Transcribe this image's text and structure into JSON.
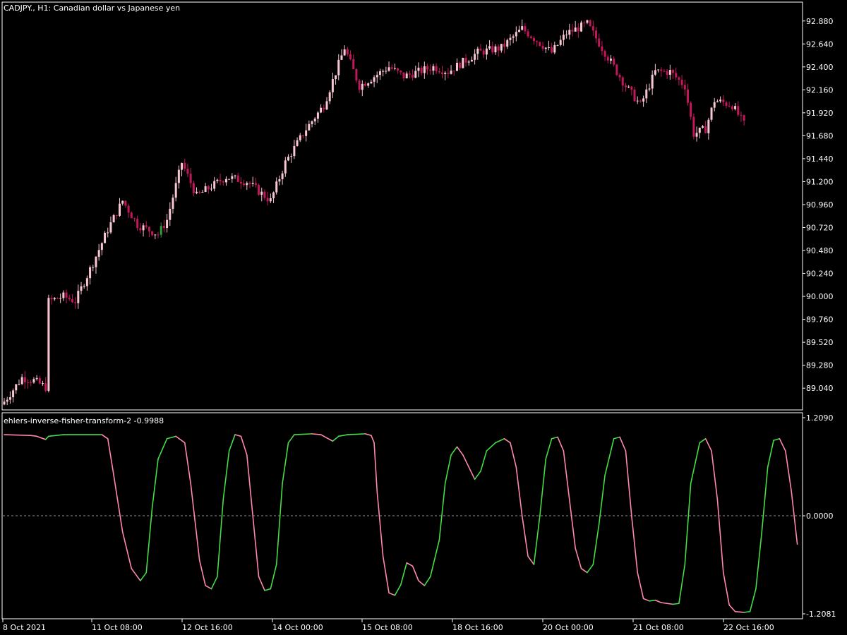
{
  "window": {
    "title": "CADJPY., H1:  Canadian dollar vs Japanese yen"
  },
  "indicator": {
    "name": "ehlers-inverse-fisher-transform-2",
    "last_value": "-0.9988"
  },
  "colors": {
    "background": "#000000",
    "frame": "#ffffff",
    "bear_candle": "#c2185b",
    "bull_candle": "#f8c7d2",
    "highlight_candle": "#2e9e3a",
    "indicator_up": "#44dd44",
    "indicator_down": "#ff88aa",
    "zero_line": "#8a8a8a"
  },
  "chart_data": [
    {
      "type": "candlestick",
      "title": "CADJPY., H1:  Canadian dollar vs Japanese yen",
      "symbol": "CADJPY.",
      "timeframe": "H1",
      "ylim": [
        88.82,
        93.07
      ],
      "y_ticks": [
        "92.880",
        "92.640",
        "92.400",
        "92.160",
        "91.920",
        "91.680",
        "91.440",
        "91.200",
        "90.960",
        "90.720",
        "90.480",
        "90.240",
        "90.000",
        "89.760",
        "89.520",
        "89.280",
        "89.040"
      ],
      "x_ticks": [
        "8 Oct 2021",
        "11 Oct 08:00",
        "12 Oct 16:00",
        "14 Oct 00:00",
        "15 Oct 08:00",
        "18 Oct 16:00",
        "20 Oct 00:00",
        "21 Oct 08:00",
        "22 Oct 16:00"
      ],
      "close_path": [
        [
          0,
          88.9
        ],
        [
          6,
          89.15
        ],
        [
          10,
          89.12
        ],
        [
          14,
          89.05
        ],
        [
          15,
          89.95
        ],
        [
          20,
          90.0
        ],
        [
          24,
          89.95
        ],
        [
          30,
          90.35
        ],
        [
          35,
          90.7
        ],
        [
          40,
          91.0
        ],
        [
          45,
          90.75
        ],
        [
          52,
          90.65
        ],
        [
          55,
          90.8
        ],
        [
          60,
          91.4
        ],
        [
          65,
          91.05
        ],
        [
          75,
          91.25
        ],
        [
          82,
          91.2
        ],
        [
          90,
          91.0
        ],
        [
          95,
          91.4
        ],
        [
          102,
          91.75
        ],
        [
          108,
          92.0
        ],
        [
          115,
          92.6
        ],
        [
          120,
          92.2
        ],
        [
          130,
          92.4
        ],
        [
          135,
          92.3
        ],
        [
          140,
          92.35
        ],
        [
          145,
          92.4
        ],
        [
          150,
          92.35
        ],
        [
          160,
          92.55
        ],
        [
          168,
          92.6
        ],
        [
          175,
          92.8
        ],
        [
          185,
          92.55
        ],
        [
          190,
          92.75
        ],
        [
          197,
          92.85
        ],
        [
          202,
          92.6
        ],
        [
          210,
          92.2
        ],
        [
          215,
          92.0
        ],
        [
          220,
          92.35
        ],
        [
          225,
          92.35
        ],
        [
          230,
          92.2
        ],
        [
          233,
          91.7
        ],
        [
          237,
          91.75
        ],
        [
          240,
          92.05
        ],
        [
          246,
          92.0
        ],
        [
          250,
          91.8
        ]
      ],
      "highlight_index": 53
    },
    {
      "type": "line",
      "title": "ehlers-inverse-fisher-transform-2 -0.9988",
      "ylim": [
        -1.2081,
        1.209
      ],
      "y_ticks": [
        "1.2090",
        "0.0000",
        "-1.2081"
      ],
      "reference_level": 0.0,
      "points": [
        [
          0,
          1.0
        ],
        [
          9,
          0.99
        ],
        [
          11,
          0.98
        ],
        [
          14,
          0.94
        ],
        [
          15,
          0.98
        ],
        [
          20,
          1.0
        ],
        [
          30,
          1.0
        ],
        [
          33,
          1.0
        ],
        [
          35,
          0.95
        ],
        [
          37,
          0.5
        ],
        [
          40,
          -0.2
        ],
        [
          43,
          -0.65
        ],
        [
          45,
          -0.75
        ],
        [
          46,
          -0.8
        ],
        [
          48,
          -0.7
        ],
        [
          50,
          0.1
        ],
        [
          52,
          0.7
        ],
        [
          55,
          0.95
        ],
        [
          58,
          0.98
        ],
        [
          61,
          0.9
        ],
        [
          63,
          0.4
        ],
        [
          66,
          -0.55
        ],
        [
          68,
          -0.86
        ],
        [
          70,
          -0.9
        ],
        [
          72,
          -0.75
        ],
        [
          74,
          0.2
        ],
        [
          76,
          0.8
        ],
        [
          78,
          1.0
        ],
        [
          80,
          0.98
        ],
        [
          82,
          0.75
        ],
        [
          84,
          0.0
        ],
        [
          86,
          -0.75
        ],
        [
          88,
          -0.92
        ],
        [
          90,
          -0.9
        ],
        [
          92,
          -0.6
        ],
        [
          94,
          0.4
        ],
        [
          96,
          0.9
        ],
        [
          98,
          1.0
        ],
        [
          104,
          1.01
        ],
        [
          107,
          1.0
        ],
        [
          110,
          0.94
        ],
        [
          111,
          0.92
        ],
        [
          113,
          0.98
        ],
        [
          116,
          1.0
        ],
        [
          122,
          1.01
        ],
        [
          124,
          0.99
        ],
        [
          125,
          0.9
        ],
        [
          126,
          0.3
        ],
        [
          128,
          -0.5
        ],
        [
          130,
          -0.95
        ],
        [
          132,
          -0.98
        ],
        [
          134,
          -0.85
        ],
        [
          136,
          -0.58
        ],
        [
          138,
          -0.62
        ],
        [
          140,
          -0.8
        ],
        [
          142,
          -0.86
        ],
        [
          144,
          -0.75
        ],
        [
          147,
          -0.3
        ],
        [
          149,
          0.4
        ],
        [
          151,
          0.75
        ],
        [
          153,
          0.85
        ],
        [
          155,
          0.75
        ],
        [
          157,
          0.6
        ],
        [
          159,
          0.45
        ],
        [
          161,
          0.55
        ],
        [
          163,
          0.8
        ],
        [
          166,
          0.9
        ],
        [
          169,
          0.95
        ],
        [
          171,
          0.9
        ],
        [
          173,
          0.6
        ],
        [
          175,
          0.0
        ],
        [
          177,
          -0.5
        ],
        [
          179,
          -0.6
        ],
        [
          181,
          0.0
        ],
        [
          183,
          0.7
        ],
        [
          185,
          0.95
        ],
        [
          187,
          0.97
        ],
        [
          189,
          0.8
        ],
        [
          191,
          0.2
        ],
        [
          193,
          -0.4
        ],
        [
          195,
          -0.65
        ],
        [
          197,
          -0.7
        ],
        [
          199,
          -0.6
        ],
        [
          201,
          -0.1
        ],
        [
          203,
          0.5
        ],
        [
          206,
          0.95
        ],
        [
          208,
          0.97
        ],
        [
          210,
          0.8
        ],
        [
          212,
          0.0
        ],
        [
          214,
          -0.7
        ],
        [
          216,
          -1.02
        ],
        [
          218,
          -1.05
        ],
        [
          220,
          -1.04
        ],
        [
          222,
          -1.07
        ],
        [
          224,
          -1.08
        ],
        [
          226,
          -1.09
        ],
        [
          228,
          -1.08
        ],
        [
          230,
          -0.6
        ],
        [
          232,
          0.4
        ],
        [
          235,
          0.9
        ],
        [
          237,
          0.95
        ],
        [
          239,
          0.8
        ],
        [
          241,
          0.2
        ],
        [
          243,
          -0.7
        ],
        [
          245,
          -1.1
        ],
        [
          247,
          -1.18
        ],
        [
          250,
          -1.19
        ],
        [
          252,
          -1.18
        ],
        [
          254,
          -0.9
        ],
        [
          256,
          -0.2
        ],
        [
          258,
          0.6
        ],
        [
          260,
          0.93
        ],
        [
          262,
          0.95
        ],
        [
          264,
          0.8
        ],
        [
          266,
          0.3
        ],
        [
          268,
          -0.35
        ]
      ]
    }
  ]
}
